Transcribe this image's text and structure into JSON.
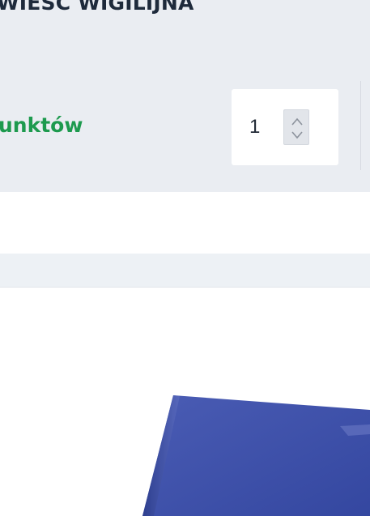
{
  "product": {
    "title": "WIEŚĆ WIGILIJNA",
    "points_label": "unktów",
    "quantity": {
      "value": "1",
      "stepper_icon": "up-down-chevrons"
    }
  },
  "image": {
    "alt_color": "#3d4fa3"
  },
  "colors": {
    "card_background": "#eaedf2",
    "title": "#1e2a3b",
    "points_green": "#1d9a4e",
    "strip": "#edf1f5"
  }
}
